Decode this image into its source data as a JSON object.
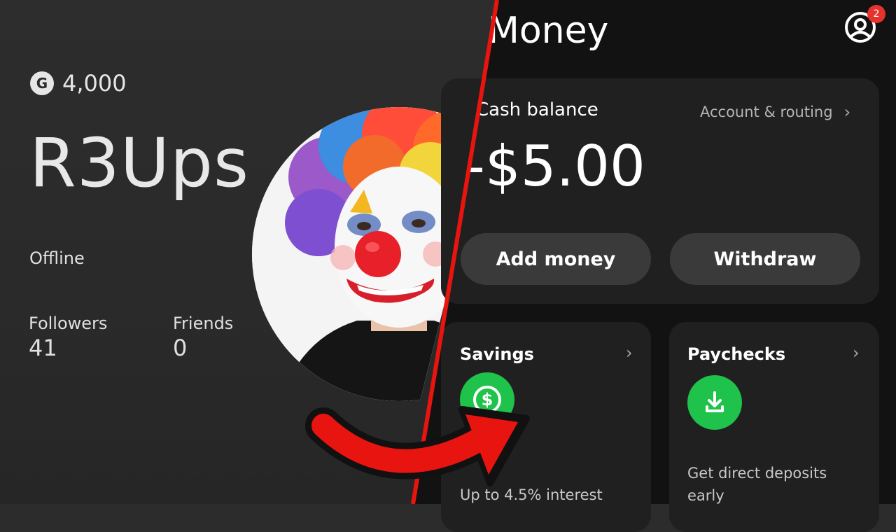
{
  "profile": {
    "currency_icon": "G",
    "currency_balance": "4,000",
    "username": "R3Ups",
    "status": "Offline",
    "followers_label": "Followers",
    "followers_count": "41",
    "friends_label": "Friends",
    "friends_count": "0",
    "avatar_icon": "clown-avatar-icon"
  },
  "money": {
    "title": "Money",
    "notification_count": "2",
    "cash_balance_label": "Cash balance",
    "account_link": "Account & routing",
    "cash_amount": "-$5.00",
    "add_money_label": "Add money",
    "withdraw_label": "Withdraw",
    "savings": {
      "title": "Savings",
      "description": "Up to 4.5% interest",
      "icon": "dollar-icon"
    },
    "paychecks": {
      "title": "Paychecks",
      "description": "Get direct deposits early",
      "icon": "download-icon"
    }
  },
  "colors": {
    "accent_green": "#1fc24a",
    "divider_red": "#e8140f",
    "badge_red": "#e5322d"
  }
}
